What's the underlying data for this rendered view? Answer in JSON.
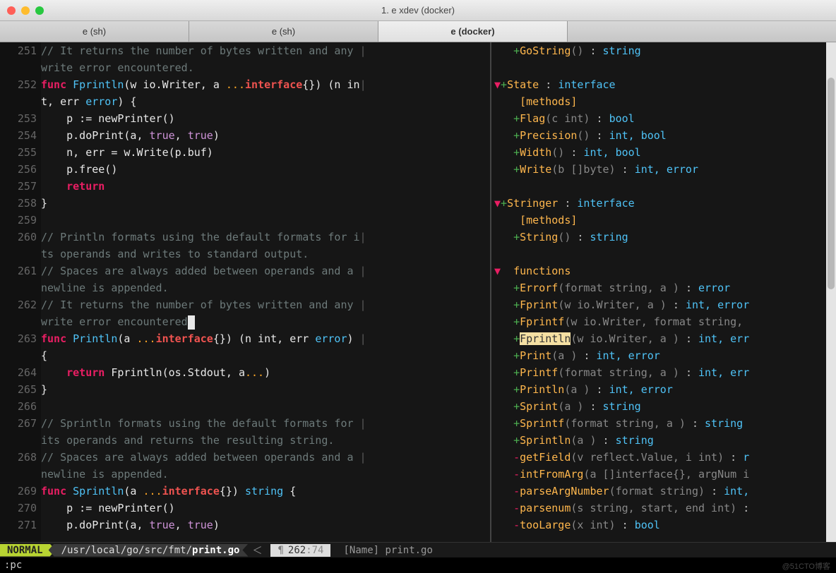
{
  "window": {
    "title": "1. e xdev (docker)"
  },
  "tabs": [
    {
      "label": "e (sh)",
      "active": false
    },
    {
      "label": "e (sh)",
      "active": false
    },
    {
      "label": "e (docker)",
      "active": true
    }
  ],
  "gutter_lines": [
    "251",
    "252",
    "253",
    "254",
    "255",
    "256",
    "257",
    "258",
    "259",
    "260",
    "261",
    "262",
    "263",
    "264",
    "265",
    "266",
    "267",
    "268",
    "269",
    "270",
    "271"
  ],
  "code": {
    "l251a": "// It returns the number of bytes written and any ",
    "l251b": "write error encountered.",
    "l252_func": "func",
    "l252_name": " Fprintln",
    "l252_sig1": "(w io.Writer, a ",
    "l252_dots": "...",
    "l252_iface": "interface",
    "l252_sig2": "{}) (n in",
    "l252_sig3": "t, err ",
    "l252_err": "error",
    "l252_brace": ") {",
    "l253": "    p := newPrinter()",
    "l254a": "    p.doPrint(a, ",
    "l254_t1": "true",
    "l254_c1": ", ",
    "l254_t2": "true",
    "l254_c2": ")",
    "l255": "    n, err = w.Write(p.buf)",
    "l256": "    p.free()",
    "l257": "    return",
    "l258": "}",
    "l260a": "// Println formats using the default formats for i",
    "l260b": "ts operands and writes to standard output.",
    "l261a": "// Spaces are always added between operands and a ",
    "l261b": "newline is appended.",
    "l262a": "// It returns the number of bytes written and any ",
    "l262b": "write error encountered",
    "l263_func": "func",
    "l263_name": " Println",
    "l263_sig1": "(a ",
    "l263_dots": "...",
    "l263_iface": "interface",
    "l263_sig2": "{}) (n int, err ",
    "l263_err": "error",
    "l263_brace": ") ",
    "l263_brace2": "{",
    "l264_ret": "    return",
    "l264_rest": " Fprintln(os.Stdout, a",
    "l264_dots": "...",
    "l264_end": ")",
    "l265": "}",
    "l267a": "// Sprintln formats using the default formats for ",
    "l267b": "its operands and returns the resulting string.",
    "l268a": "// Spaces are always added between operands and a ",
    "l268b": "newline is appended.",
    "l269_func": "func",
    "l269_name": " Sprintln",
    "l269_sig1": "(a ",
    "l269_dots": "...",
    "l269_iface": "interface",
    "l269_sig2": "{}) ",
    "l269_ret": "string",
    "l269_brace": " {",
    "l270": "    p := newPrinter()",
    "l271a": "    p.doPrint(a, ",
    "l271_t1": "true",
    "l271_c1": ", ",
    "l271_t2": "true",
    "l271_c2": ")"
  },
  "outline": [
    {
      "kind": "method",
      "name": "GoString",
      "sig": "()",
      "ret": "string"
    },
    {
      "kind": "blank"
    },
    {
      "kind": "iface",
      "name": "State",
      "ret": "interface",
      "collapse": true
    },
    {
      "kind": "header",
      "label": "[methods]"
    },
    {
      "kind": "method",
      "name": "Flag",
      "sig": "(c int)",
      "ret": "bool"
    },
    {
      "kind": "method",
      "name": "Precision",
      "sig": "()",
      "ret": "int, bool"
    },
    {
      "kind": "method",
      "name": "Width",
      "sig": "()",
      "ret": "int, bool"
    },
    {
      "kind": "method",
      "name": "Write",
      "sig": "(b []byte)",
      "ret": "int, error"
    },
    {
      "kind": "blank"
    },
    {
      "kind": "iface",
      "name": "Stringer",
      "ret": "interface",
      "collapse": true
    },
    {
      "kind": "header",
      "label": "[methods]"
    },
    {
      "kind": "method",
      "name": "String",
      "sig": "()",
      "ret": "string"
    },
    {
      "kind": "blank"
    },
    {
      "kind": "section",
      "label": "functions",
      "collapse": true
    },
    {
      "kind": "func",
      "name": "Errorf",
      "sig": "(format string, a )",
      "ret": "error"
    },
    {
      "kind": "func",
      "name": "Fprint",
      "sig": "(w io.Writer, a )",
      "ret": "int, error"
    },
    {
      "kind": "func",
      "name": "Fprintf",
      "sig": "(w io.Writer, format string, "
    },
    {
      "kind": "func",
      "name": "Fprintln",
      "sig": "(w io.Writer, a )",
      "ret": "int, err",
      "hl": true
    },
    {
      "kind": "func",
      "name": "Print",
      "sig": "(a )",
      "ret": "int, error"
    },
    {
      "kind": "func",
      "name": "Printf",
      "sig": "(format string, a )",
      "ret": "int, err"
    },
    {
      "kind": "func",
      "name": "Println",
      "sig": "(a )",
      "ret": "int, error"
    },
    {
      "kind": "func",
      "name": "Sprint",
      "sig": "(a )",
      "ret": "string"
    },
    {
      "kind": "func",
      "name": "Sprintf",
      "sig": "(format string, a )",
      "ret": "string"
    },
    {
      "kind": "func",
      "name": "Sprintln",
      "sig": "(a )",
      "ret": "string"
    },
    {
      "kind": "priv",
      "name": "getField",
      "sig": "(v reflect.Value, i int)",
      "ret": "r"
    },
    {
      "kind": "priv",
      "name": "intFromArg",
      "sig": "(a []interface{}, argNum i"
    },
    {
      "kind": "priv",
      "name": "parseArgNumber",
      "sig": "(format string)",
      "ret": "int,"
    },
    {
      "kind": "priv",
      "name": "parsenum",
      "sig": "(s string, start, end int)",
      "ret": ""
    },
    {
      "kind": "priv",
      "name": "tooLarge",
      "sig": "(x int)",
      "ret": "bool"
    }
  ],
  "status": {
    "mode": "NORMAL",
    "path_prefix": "/usr/local/go/src/fmt/",
    "path_file": "print.go",
    "line": "262",
    "col": "74",
    "right": "[Name]  print.go"
  },
  "cmdline": ":pc",
  "watermark": "@51CTO博客"
}
